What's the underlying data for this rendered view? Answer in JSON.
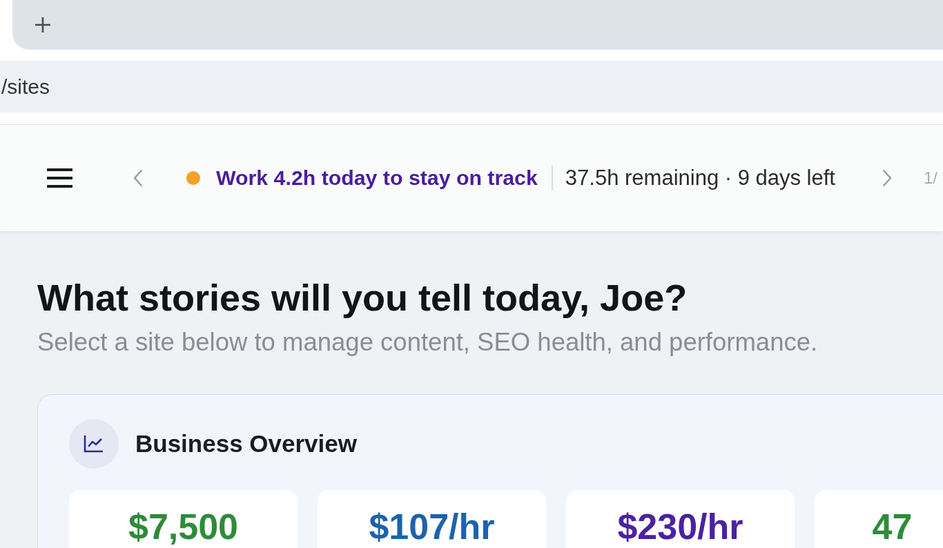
{
  "address_bar": {
    "url": "/sites"
  },
  "header": {
    "goal": "Work 4.2h today to stay on track",
    "details": "37.5h remaining · 9 days left",
    "pager": "1/"
  },
  "greeting": {
    "title": "What stories will you tell today, Joe?",
    "subtitle": "Select a site below to manage content, SEO health, and performance."
  },
  "overview": {
    "title": "Business Overview",
    "stats": [
      {
        "value": "$7,500",
        "color": "#2e8b3a"
      },
      {
        "value": "$107/hr",
        "color": "#1e62ad"
      },
      {
        "value": "$230/hr",
        "color": "#4b22a0"
      },
      {
        "value": "47",
        "color": "#2e8b3a"
      }
    ]
  }
}
